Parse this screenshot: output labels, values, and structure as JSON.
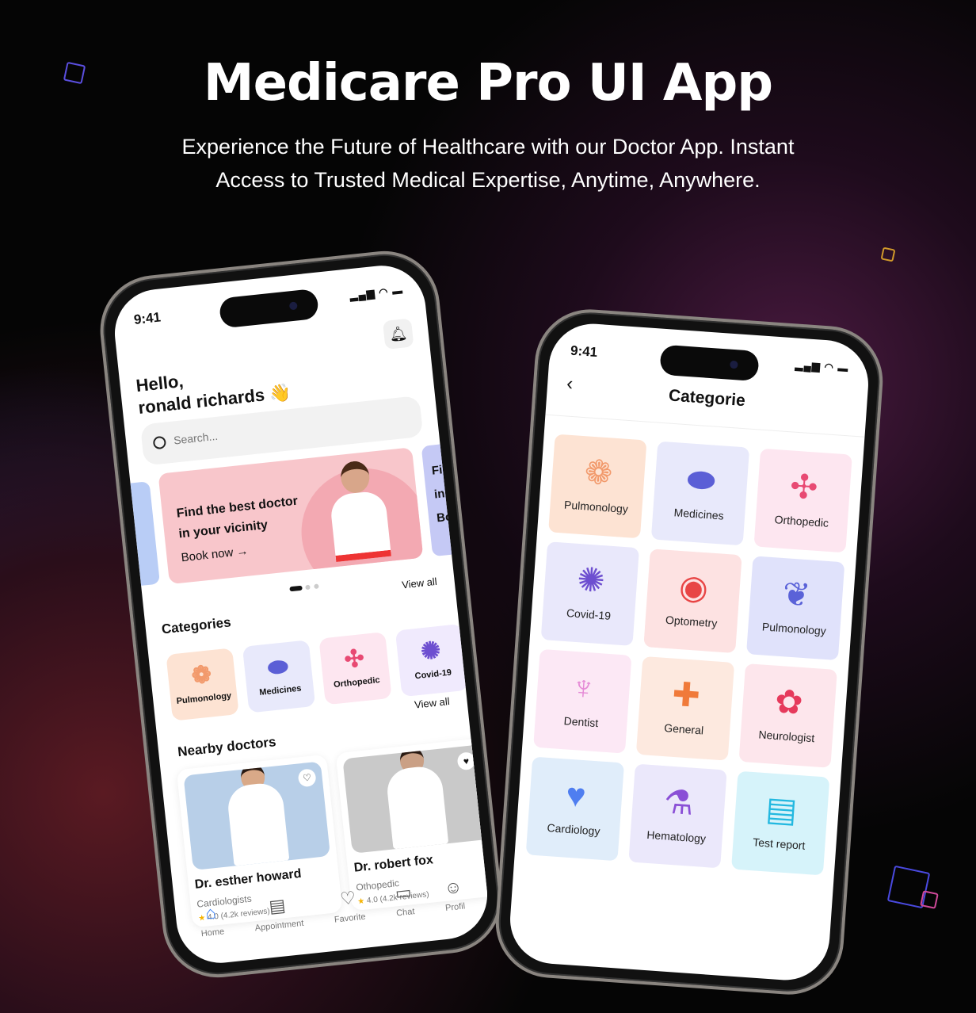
{
  "hero": {
    "title": "Medicare Pro UI App",
    "subtitle_line1": "Experience the Future of Healthcare with our Doctor App. Instant",
    "subtitle_line2": "Access to Trusted Medical Expertise, Anytime, Anywhere."
  },
  "home": {
    "time": "9:41",
    "greeting": "Hello,",
    "user_name": "ronald richards",
    "wave": "👋",
    "search_placeholder": "Search...",
    "banner": {
      "line1": "Find the best doctor",
      "line2": "in your vicinity",
      "cta": "Book now",
      "arrow": "→",
      "next_peek": [
        "Fi",
        "in",
        "Bo"
      ]
    },
    "categories_title": "Categories",
    "view_all": "View all",
    "categories": [
      {
        "label": "Pulmonology",
        "color": "#fde3d3",
        "icon": "lungs-icon"
      },
      {
        "label": "Medicines",
        "color": "#e8e9fb",
        "icon": "pills-icon"
      },
      {
        "label": "Orthopedic",
        "color": "#fde6f0",
        "icon": "joint-icon"
      },
      {
        "label": "Covid-19",
        "color": "#f0eafd",
        "icon": "virus-icon"
      }
    ],
    "nearby_title": "Nearby doctors",
    "doctors": [
      {
        "name": "Dr. esther howard",
        "specialty": "Cardiologists",
        "rating": "4.0",
        "reviews": "(4.2k reviews)",
        "favorited": false
      },
      {
        "name": "Dr. robert fox",
        "specialty": "Othopedic",
        "rating": "4.0",
        "reviews": "(4.2k reviews)",
        "favorited": true
      }
    ],
    "nav": [
      {
        "label": "Home",
        "icon": "home-icon",
        "active": true
      },
      {
        "label": "Appointment",
        "icon": "clipboard-icon"
      },
      {
        "label": "Favorite",
        "icon": "heart-icon"
      },
      {
        "label": "Chat",
        "icon": "chat-icon"
      },
      {
        "label": "Profil",
        "icon": "user-icon"
      }
    ],
    "accent": "#3b82f6"
  },
  "categorie": {
    "time": "9:41",
    "title": "Categorie",
    "items": [
      {
        "label": "Pulmonology",
        "color": "#fde3d3",
        "glyph": "❁",
        "glyph_color": "#f29a6c"
      },
      {
        "label": "Medicines",
        "color": "#e8e9fb",
        "glyph": "⬬",
        "glyph_color": "#5b5fd6"
      },
      {
        "label": "Orthopedic",
        "color": "#fde6f0",
        "glyph": "✣",
        "glyph_color": "#e84a73"
      },
      {
        "label": "Covid-19",
        "color": "#e9e8fb",
        "glyph": "✺",
        "glyph_color": "#6d4fd0"
      },
      {
        "label": "Optometry",
        "color": "#fde2e2",
        "glyph": "◉",
        "glyph_color": "#e84545"
      },
      {
        "label": "Pulmonology",
        "color": "#e0e2fb",
        "glyph": "❦",
        "glyph_color": "#5a62d8"
      },
      {
        "label": "Dentist",
        "color": "#fce8f5",
        "glyph": "♆",
        "glyph_color": "#e58ad6"
      },
      {
        "label": "General",
        "color": "#fde9df",
        "glyph": "✚",
        "glyph_color": "#f07a3a"
      },
      {
        "label": "Neurologist",
        "color": "#fde6ec",
        "glyph": "✿",
        "glyph_color": "#e63a5c"
      },
      {
        "label": "Cardiology",
        "color": "#e0edfa",
        "glyph": "♥",
        "glyph_color": "#4f7ef0"
      },
      {
        "label": "Hematology",
        "color": "#ebe8fb",
        "glyph": "⚗",
        "glyph_color": "#8a4fd6"
      },
      {
        "label": "Test report",
        "color": "#d6f3fa",
        "glyph": "▤",
        "glyph_color": "#22b8e0"
      }
    ]
  }
}
